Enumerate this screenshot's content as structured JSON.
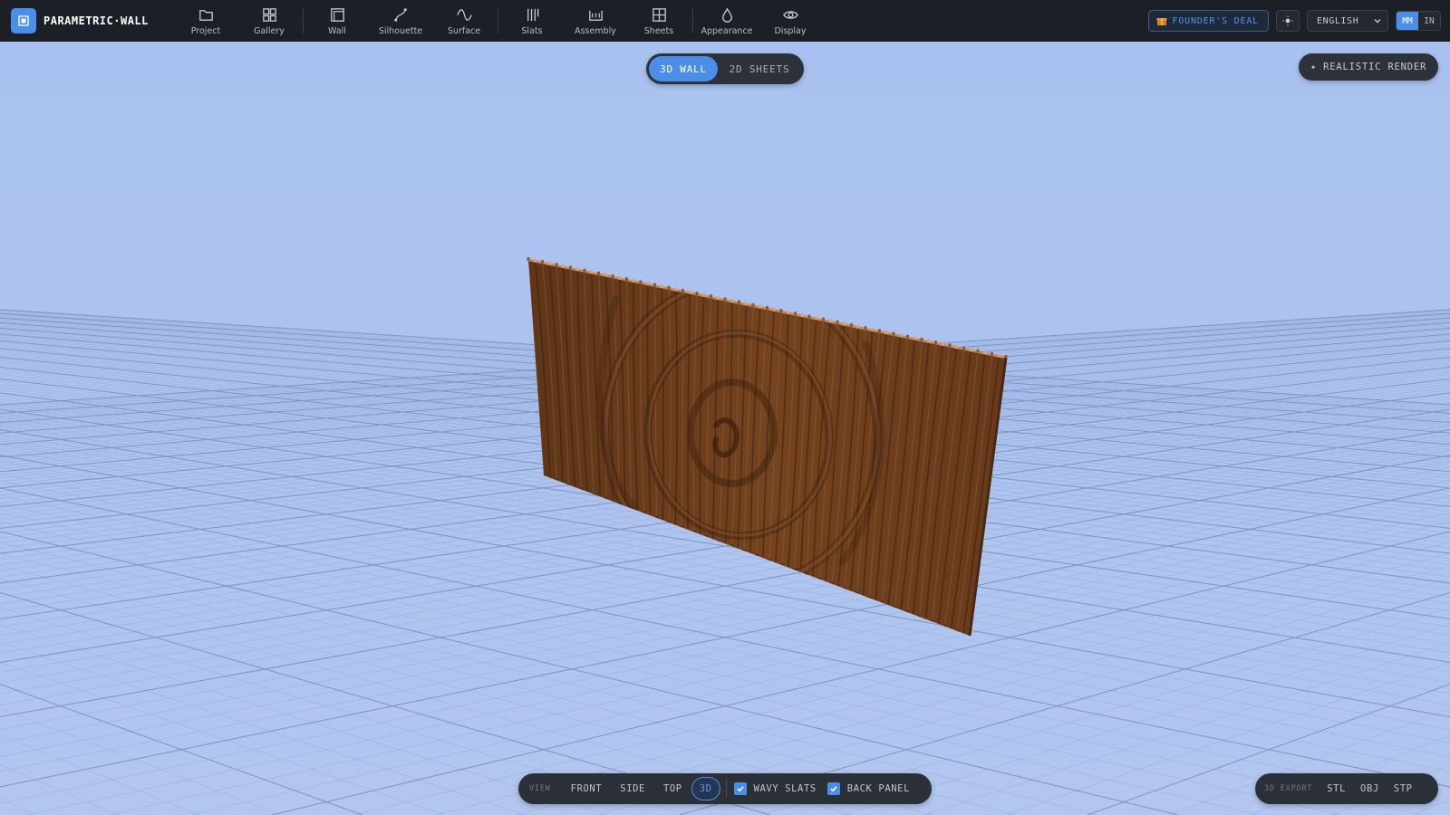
{
  "app": {
    "name": "PARAMETRIC·WALL",
    "logo_icon": "wall-logo-icon",
    "accent_color": "#4a8ee8",
    "topbar_bg": "#1c1f26",
    "viewport_bg": "#aec3ef"
  },
  "nav": {
    "items": [
      {
        "label": "Project",
        "icon": "folder-icon"
      },
      {
        "label": "Gallery",
        "icon": "grid-icon"
      },
      {
        "label": "Wall",
        "icon": "wall-frame-icon"
      },
      {
        "label": "Silhouette",
        "icon": "curve-icon"
      },
      {
        "label": "Surface",
        "icon": "wave-icon"
      },
      {
        "label": "Slats",
        "icon": "slats-icon"
      },
      {
        "label": "Assembly",
        "icon": "assembly-icon"
      },
      {
        "label": "Sheets",
        "icon": "sheets-icon"
      },
      {
        "label": "Appearance",
        "icon": "droplet-icon"
      },
      {
        "label": "Display",
        "icon": "eye-icon"
      }
    ]
  },
  "header_right": {
    "founders_deal": "FOUNDER'S DEAL",
    "founders_color": "#4f93e8",
    "language": "ENGLISH",
    "units": [
      "MM",
      "IN"
    ],
    "active_unit": "MM"
  },
  "mode": {
    "options": [
      "3D WALL",
      "2D SHEETS"
    ],
    "active": "3D WALL"
  },
  "render_button": "✦ REALISTIC RENDER",
  "view_bar": {
    "label": "VIEW",
    "buttons": [
      "FRONT",
      "SIDE",
      "TOP",
      "3D"
    ],
    "active": "3D",
    "wavy_slats": {
      "label": "WAVY SLATS",
      "checked": true
    },
    "back_panel": {
      "label": "BACK PANEL",
      "checked": true
    }
  },
  "export_bar": {
    "label": "3D EXPORT",
    "formats": [
      "STL",
      "OBJ",
      "STP"
    ]
  },
  "wall_model": {
    "material_color": "#6b3d1d",
    "highlight_color": "#9a6238",
    "shadow_color": "#3a1e0c"
  }
}
